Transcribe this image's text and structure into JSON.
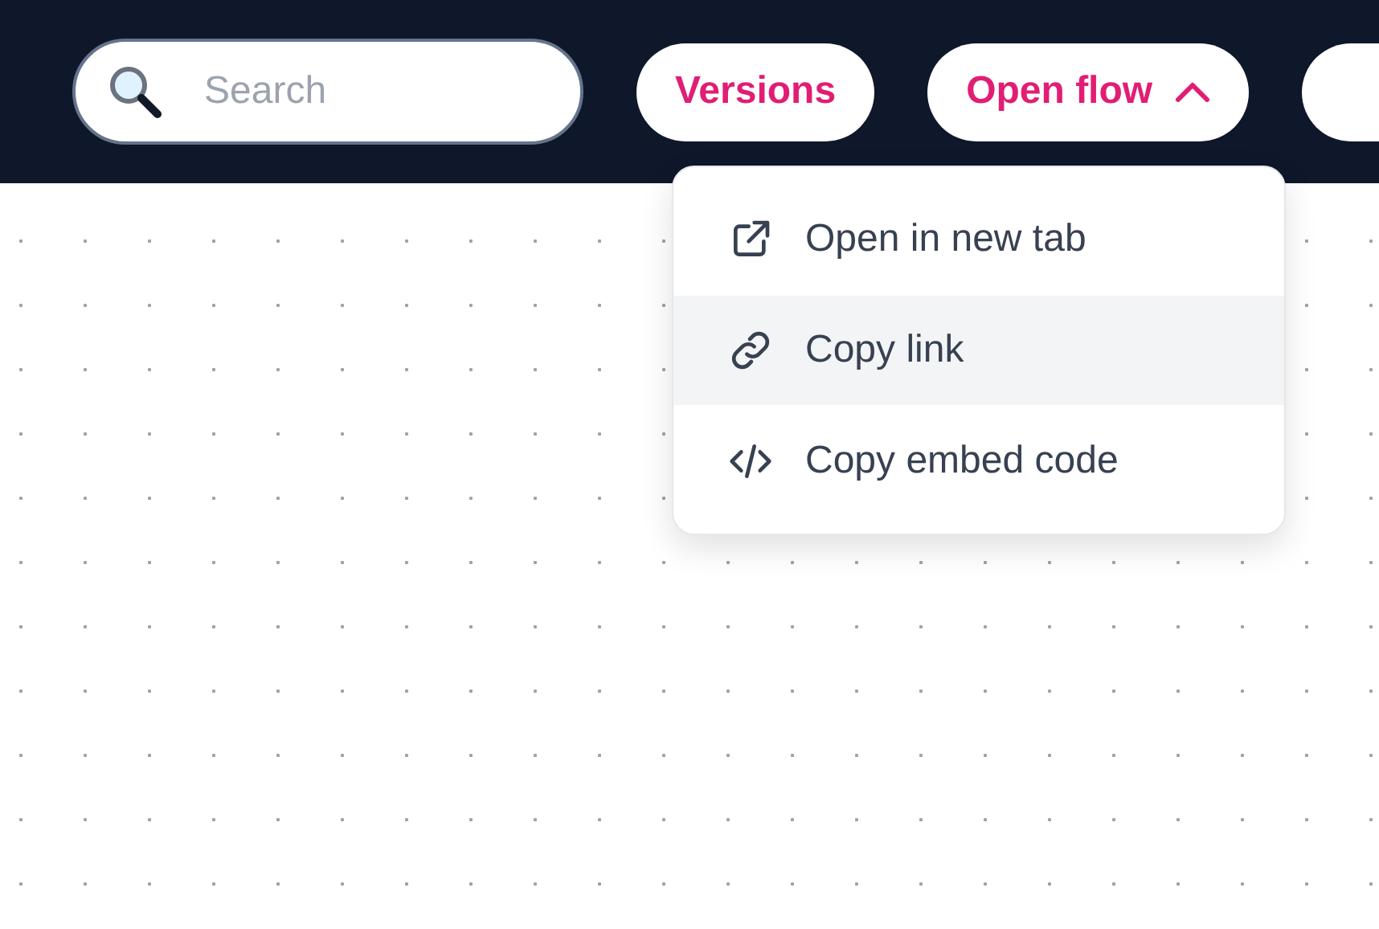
{
  "search": {
    "placeholder": "Search"
  },
  "buttons": [
    {
      "label": "Versions",
      "kind": "plain"
    },
    {
      "label": "Open flow",
      "kind": "dropdown",
      "expanded": true
    }
  ],
  "menu": {
    "items": [
      {
        "label": "Open in new tab",
        "kind": "external",
        "highlighted": false
      },
      {
        "label": "Copy link",
        "kind": "link",
        "highlighted": true
      },
      {
        "label": "Copy embed code",
        "kind": "code",
        "highlighted": false
      }
    ]
  }
}
